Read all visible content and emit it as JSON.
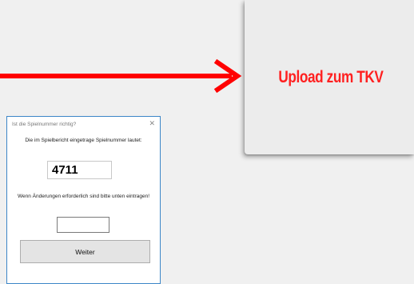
{
  "upload": {
    "label": "Upload zum TKV"
  },
  "arrow": {
    "color": "#ff0000",
    "icon": "right-arrow"
  },
  "dialog": {
    "title": "Ist die Spielnummer richtig?",
    "close_glyph": "✕",
    "prompt": "Die im Spielbericht eingetrage Spielnummer lautet:",
    "number": "4711",
    "hint": "Wenn Änderungen erforderlich sind bitte unten eintragen!",
    "input_value": "",
    "button_label": "Weiter"
  }
}
